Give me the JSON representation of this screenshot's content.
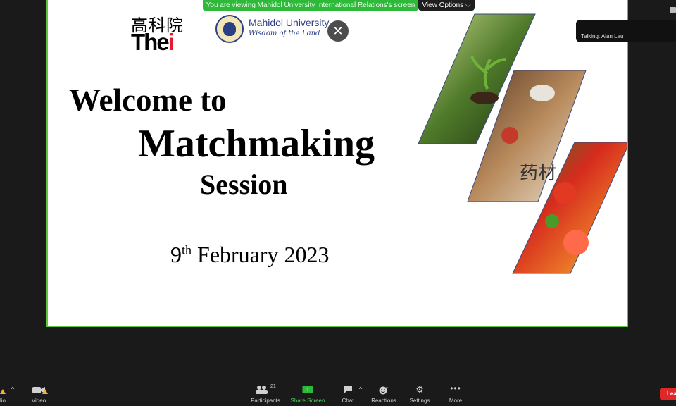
{
  "share_banner": "You are viewing Mahidol University International Relations's screen",
  "view_options_label": "View Options",
  "talking": "Talking: Alan Lau",
  "slide": {
    "thei_cn": "高科院",
    "thei_en_prefix": "The",
    "thei_en_suffix": "i",
    "mu_name": "Mahidol University",
    "mu_motto": "Wisdom of the Land",
    "title_line1": "Welcome to",
    "title_line2": "Matchmaking",
    "title_line3": "Session",
    "date_day": "9",
    "date_suffix": "th",
    "date_rest": " February 2023"
  },
  "toolbar": {
    "audio_label": "lio",
    "video_label": "Video",
    "participants_count": "21",
    "participants_label": "Participants",
    "share_label": "Share Screen",
    "chat_label": "Chat",
    "reactions_label": "Reactions",
    "settings_label": "Settings",
    "more_label": "More",
    "leave_label": "Lea"
  },
  "colors": {
    "share_green": "#2fb93a",
    "leave_red": "#e02828",
    "border_green": "#5cc83b",
    "thei_red": "#e8192c",
    "mahidol_blue": "#2b3f86"
  }
}
